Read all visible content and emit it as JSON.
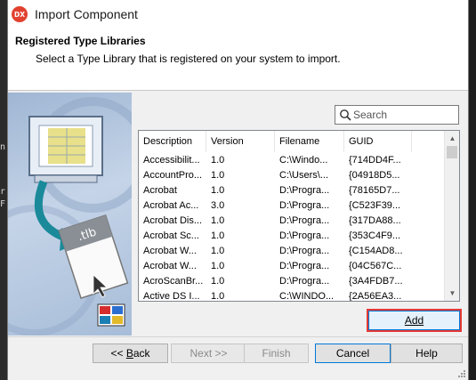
{
  "window": {
    "icon_text": "DX",
    "title": "Import Component"
  },
  "header": {
    "title": "Registered Type Libraries",
    "description": "Select a Type Library that is registered on your system to import."
  },
  "side_image": {
    "file_label": ".tlb"
  },
  "search": {
    "placeholder": "Search",
    "value": ""
  },
  "table": {
    "columns": [
      "Description",
      "Version",
      "Filename",
      "GUID"
    ],
    "rows": [
      [
        "Accessibilit...",
        "1.0",
        "C:\\Windo...",
        "{714DD4F..."
      ],
      [
        "AccountPro...",
        "1.0",
        "C:\\Users\\...",
        "{04918D5..."
      ],
      [
        "Acrobat",
        "1.0",
        "D:\\Progra...",
        "{78165D7..."
      ],
      [
        "Acrobat Ac...",
        "3.0",
        "D:\\Progra...",
        "{C523F39..."
      ],
      [
        "Acrobat Dis...",
        "1.0",
        "D:\\Progra...",
        "{317DA88..."
      ],
      [
        "Acrobat Sc...",
        "1.0",
        "D:\\Progra...",
        "{353C4F9..."
      ],
      [
        "Acrobat W...",
        "1.0",
        "D:\\Progra...",
        "{C154AD8..."
      ],
      [
        "Acrobat W...",
        "1.0",
        "D:\\Progra...",
        "{04C567C..."
      ],
      [
        "AcroScanBr...",
        "1.0",
        "D:\\Progra...",
        "{3A4FDB7..."
      ],
      [
        "Active DS I...",
        "1.0",
        "C:\\WINDO...",
        "{2A56EA3..."
      ]
    ]
  },
  "buttons": {
    "add": "Add",
    "back": "<< Back",
    "next": "Next >>",
    "finish": "Finish",
    "cancel": "Cancel",
    "help": "Help"
  },
  "colors": {
    "highlight": "#e53935",
    "accent": "#0078d7",
    "brand": "#e2412f"
  },
  "background_editor_glyphs": [
    "n",
    "r",
    "F"
  ]
}
